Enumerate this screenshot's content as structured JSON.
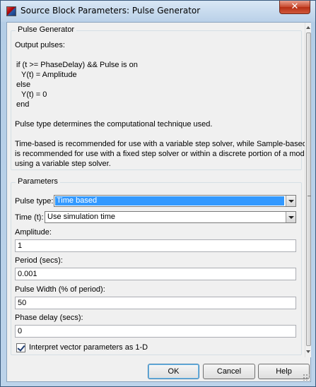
{
  "window": {
    "title": "Source Block Parameters: Pulse Generator",
    "close_glyph": "✕"
  },
  "description": {
    "group_title": "Pulse Generator",
    "lines": [
      "Output pulses:",
      "if (t >= PhaseDelay) && Pulse is on",
      "Y(t) = Amplitude",
      "else",
      "Y(t) = 0",
      "end",
      "Pulse type determines the computational technique used.",
      "Time-based is recommended for use with a variable step solver, while Sample-based",
      "is recommended for use with a fixed step solver or within a discrete portion of a model",
      "using a variable step solver."
    ]
  },
  "parameters": {
    "group_title": "Parameters",
    "pulse_type": {
      "label": "Pulse type:",
      "value": "Time based"
    },
    "time": {
      "label": "Time (t):",
      "value": "Use simulation time"
    },
    "amplitude": {
      "label": "Amplitude:",
      "value": "1"
    },
    "period": {
      "label": "Period (secs):",
      "value": "0.001"
    },
    "pulse_width": {
      "label": "Pulse Width (% of period):",
      "value": "50"
    },
    "phase_delay": {
      "label": "Phase delay (secs):",
      "value": "0"
    },
    "interpret_vector": {
      "label": "Interpret vector parameters as 1-D",
      "checked": true
    }
  },
  "buttons": {
    "ok": "OK",
    "cancel": "Cancel",
    "help": "Help"
  }
}
